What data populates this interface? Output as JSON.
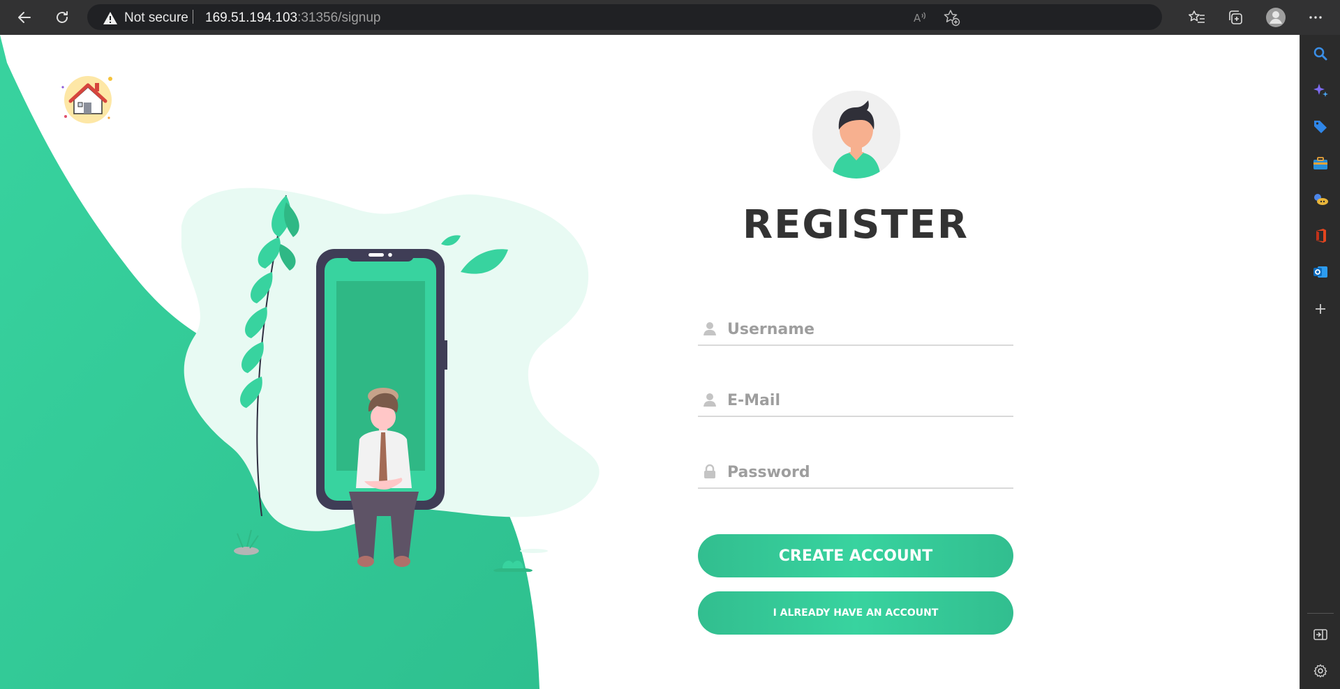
{
  "browser": {
    "security_label": "Not secure",
    "url_host": "169.51.194.103",
    "url_rest": ":31356/signup",
    "icons": [
      "back-icon",
      "refresh-icon",
      "warning-icon",
      "read-aloud-icon",
      "add-favorite-icon",
      "favorites-icon",
      "collections-icon",
      "profile-icon",
      "more-icon"
    ],
    "sidebar_icons": [
      "search-icon",
      "copilot-icon",
      "shopping-tag-icon",
      "tools-icon",
      "games-icon",
      "office-icon",
      "outlook-icon",
      "add-icon",
      "hide-sidebar-icon",
      "settings-icon"
    ]
  },
  "page": {
    "title": "REGISTER",
    "username_placeholder": "Username",
    "email_placeholder": "E-Mail",
    "password_placeholder": "Password",
    "create_button": "CREATE ACCOUNT",
    "login_button": "I ALREADY HAVE AN ACCOUNT"
  },
  "colors": {
    "accent": "#38d39f",
    "accent_dark": "#32be8f",
    "title": "#333333",
    "phone_frame": "#3f3d56"
  }
}
